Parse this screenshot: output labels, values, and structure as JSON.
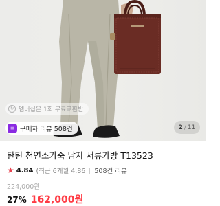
{
  "gallery": {
    "image_subject": "man-holding-leather-briefcase",
    "current_index": "2",
    "total": "11"
  },
  "member_badge": {
    "label": "멤버십은 1회 무료교환반",
    "icon": "refresh-circle-icon"
  },
  "review_chip": {
    "label": "구매자 리뷰 508건",
    "icon": "review-chat-icon",
    "icon_color": "#8a2be2"
  },
  "product": {
    "title": "탄틴 천연소가죽 남자 서류가방 T13523",
    "rating": "4.84",
    "recent_rating": "(최근 6개월 4.86",
    "recent_rating_icon": "info-icon",
    "review_count": "508건 리뷰",
    "original_price": "224,000원",
    "discount_rate": "27%",
    "sale_price": "162,000원"
  },
  "colors": {
    "accent_red": "#ff3b44",
    "star_red": "#e8434f",
    "bag_brown": "#6a2c24"
  }
}
